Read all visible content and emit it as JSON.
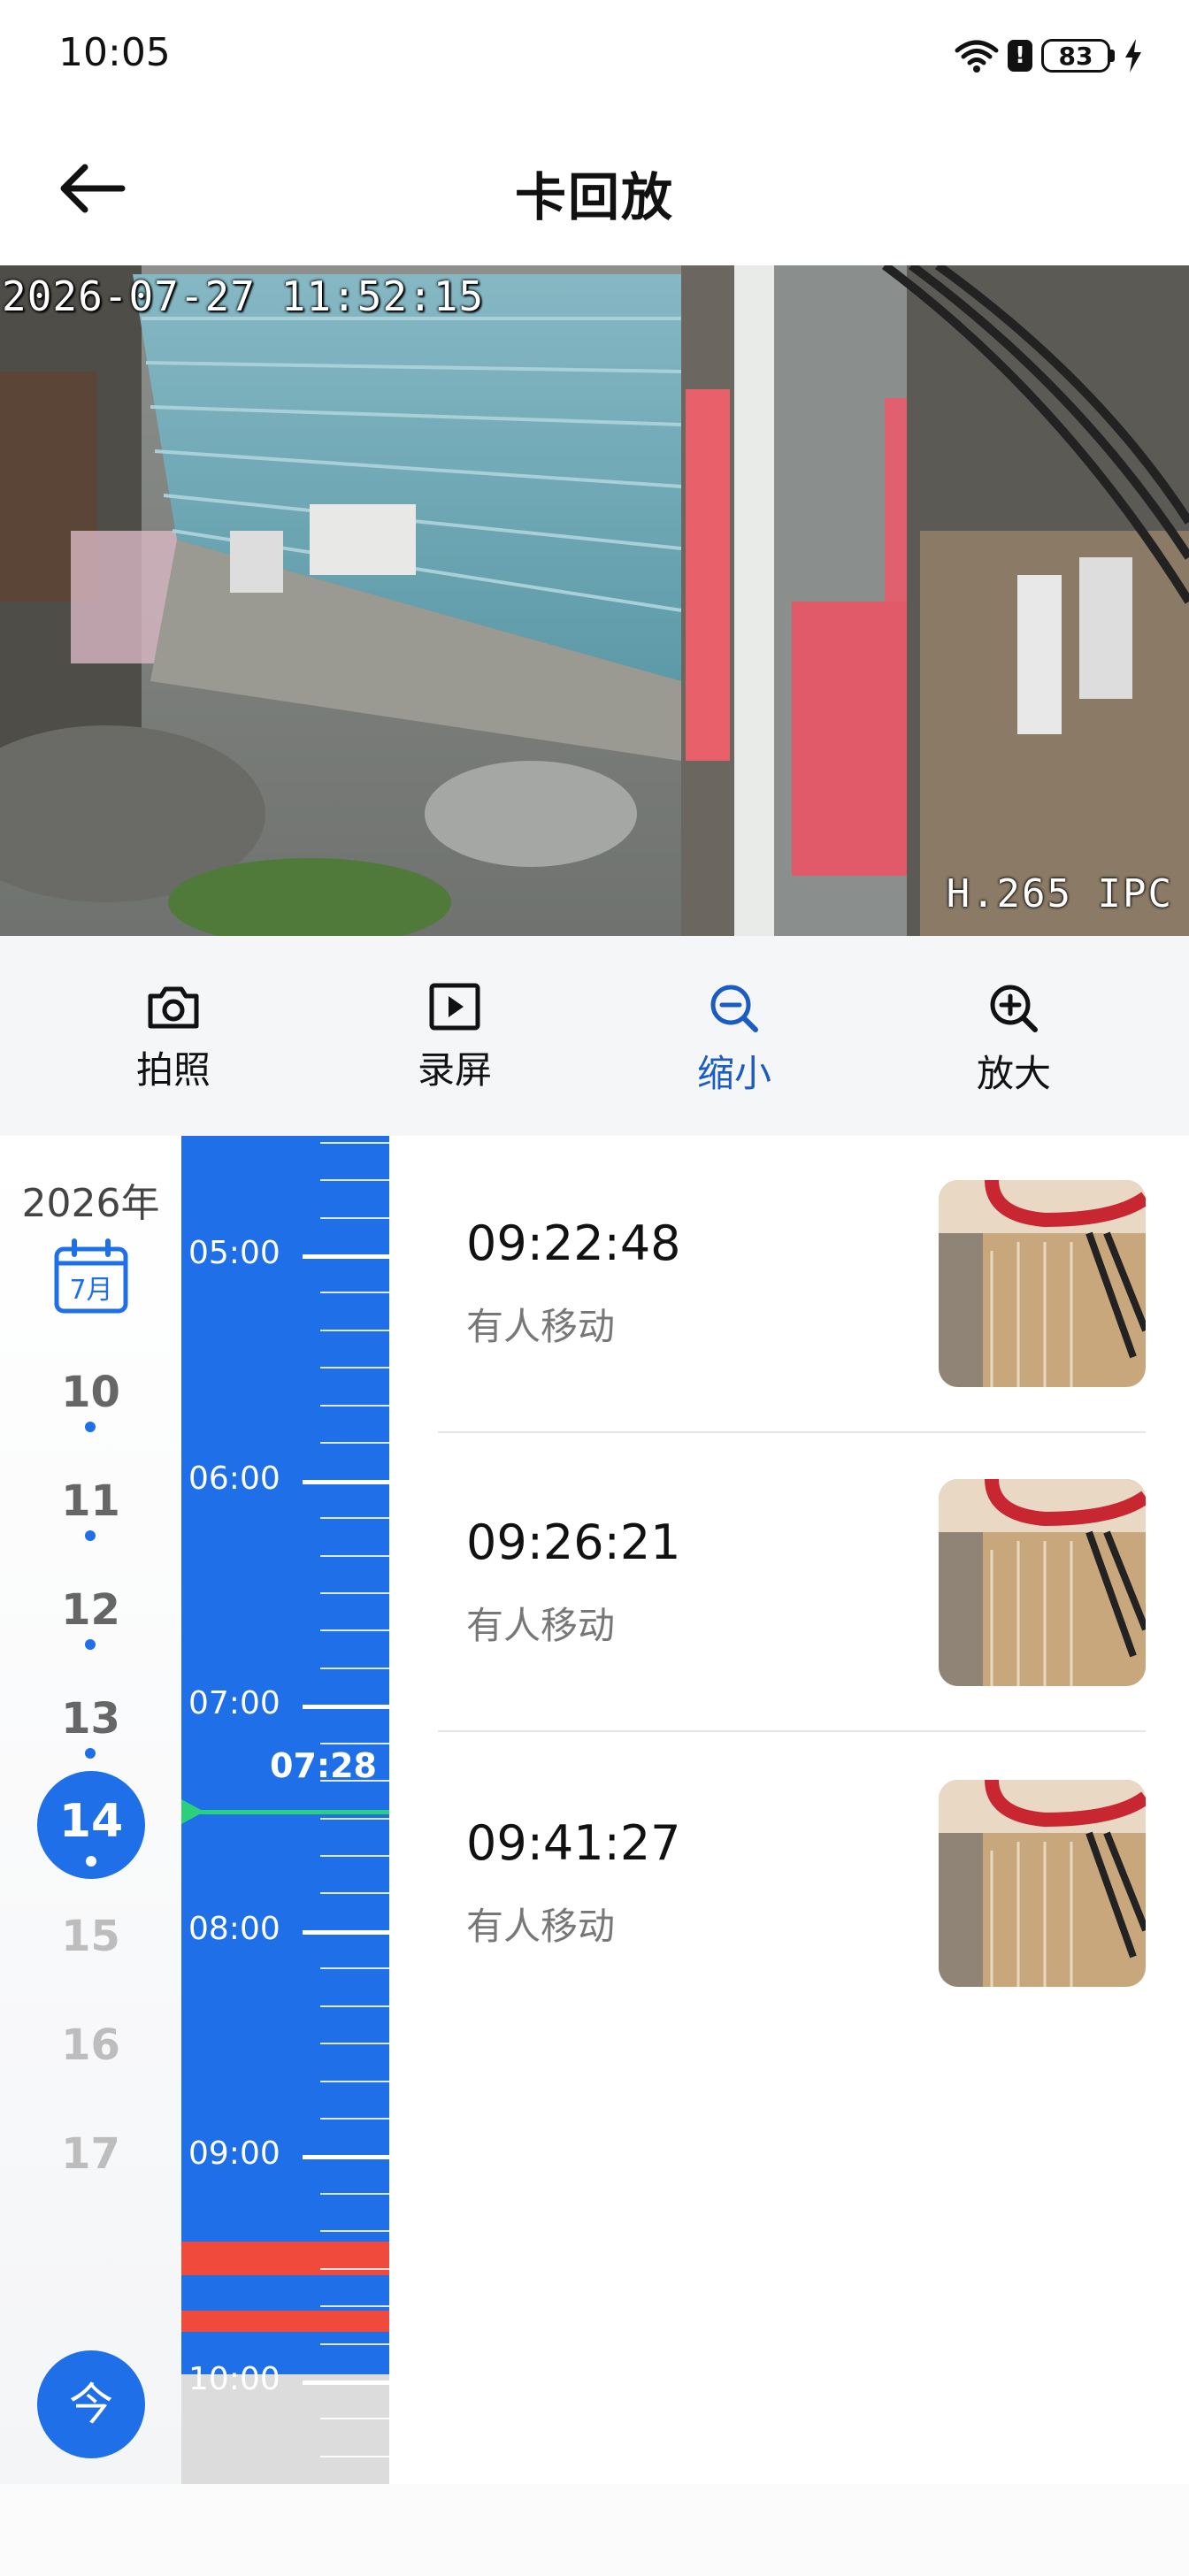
{
  "status_bar": {
    "time": "10:05",
    "battery": "83",
    "alert": "!"
  },
  "header": {
    "title": "卡回放"
  },
  "video": {
    "osd_timestamp": "2026-07-27 11:52:15",
    "osd_codec": "H.265 IPC"
  },
  "toolbar": {
    "items": [
      {
        "label": "拍照",
        "icon": "camera-icon"
      },
      {
        "label": "录屏",
        "icon": "record-icon"
      },
      {
        "label": "缩小",
        "icon": "zoom-out-icon",
        "active": true
      },
      {
        "label": "放大",
        "icon": "zoom-in-icon"
      }
    ]
  },
  "date_picker": {
    "year": "2026年",
    "month": "7月",
    "days": [
      "10",
      "11",
      "12",
      "13",
      "14",
      "15",
      "16",
      "17"
    ],
    "selected_day": "14",
    "today_label": "今"
  },
  "timeline": {
    "hours": [
      "05:00",
      "06:00",
      "07:00",
      "08:00",
      "09:00",
      "10:00"
    ],
    "cursor_time": "07:28"
  },
  "events": [
    {
      "time": "09:22:48",
      "type": "有人移动"
    },
    {
      "time": "09:26:21",
      "type": "有人移动"
    },
    {
      "time": "09:41:27",
      "type": "有人移动"
    }
  ],
  "colors": {
    "accent": "#1f6fe8",
    "record_marker": "#f04a3c",
    "cursor": "#2bd07c",
    "active_tool": "#1a5bc4"
  }
}
